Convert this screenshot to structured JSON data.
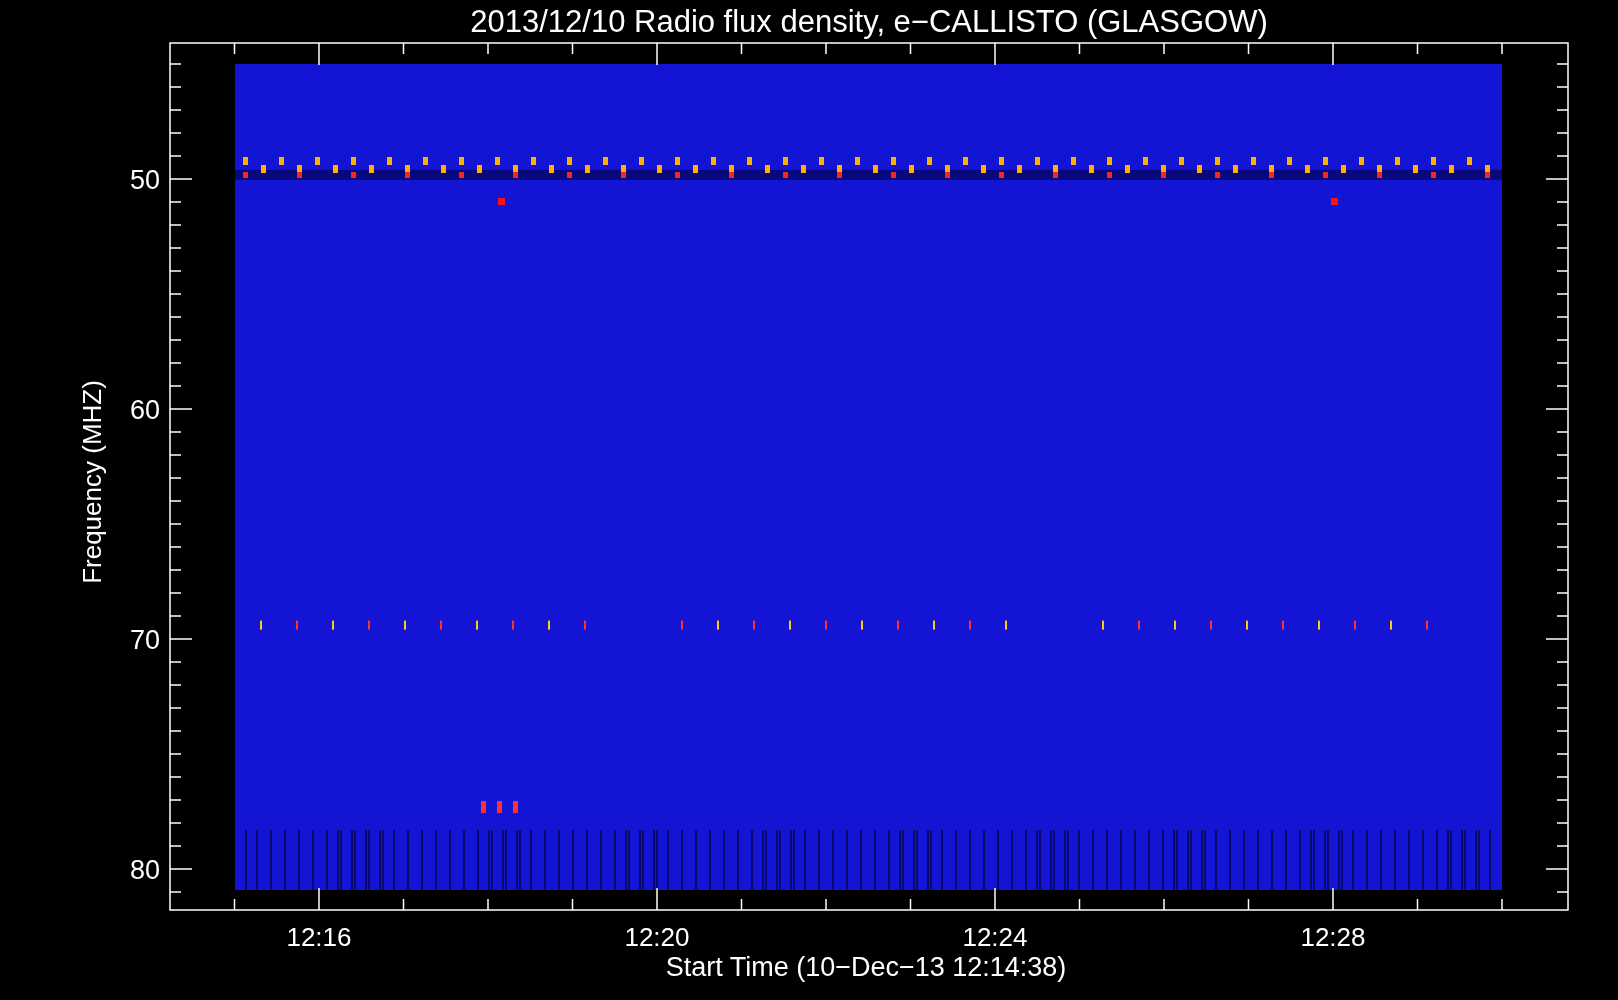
{
  "title": "2013/12/10  Radio flux density, e−CALLISTO (GLASGOW)",
  "y_axis": {
    "label": "Frequency (MHZ)",
    "ticks": [
      "50",
      "60",
      "70",
      "80"
    ]
  },
  "x_axis": {
    "label": "Start Time (10−Dec−13 12:14:38)",
    "ticks": [
      "12:16",
      "12:20",
      "12:24",
      "12:28"
    ]
  }
}
